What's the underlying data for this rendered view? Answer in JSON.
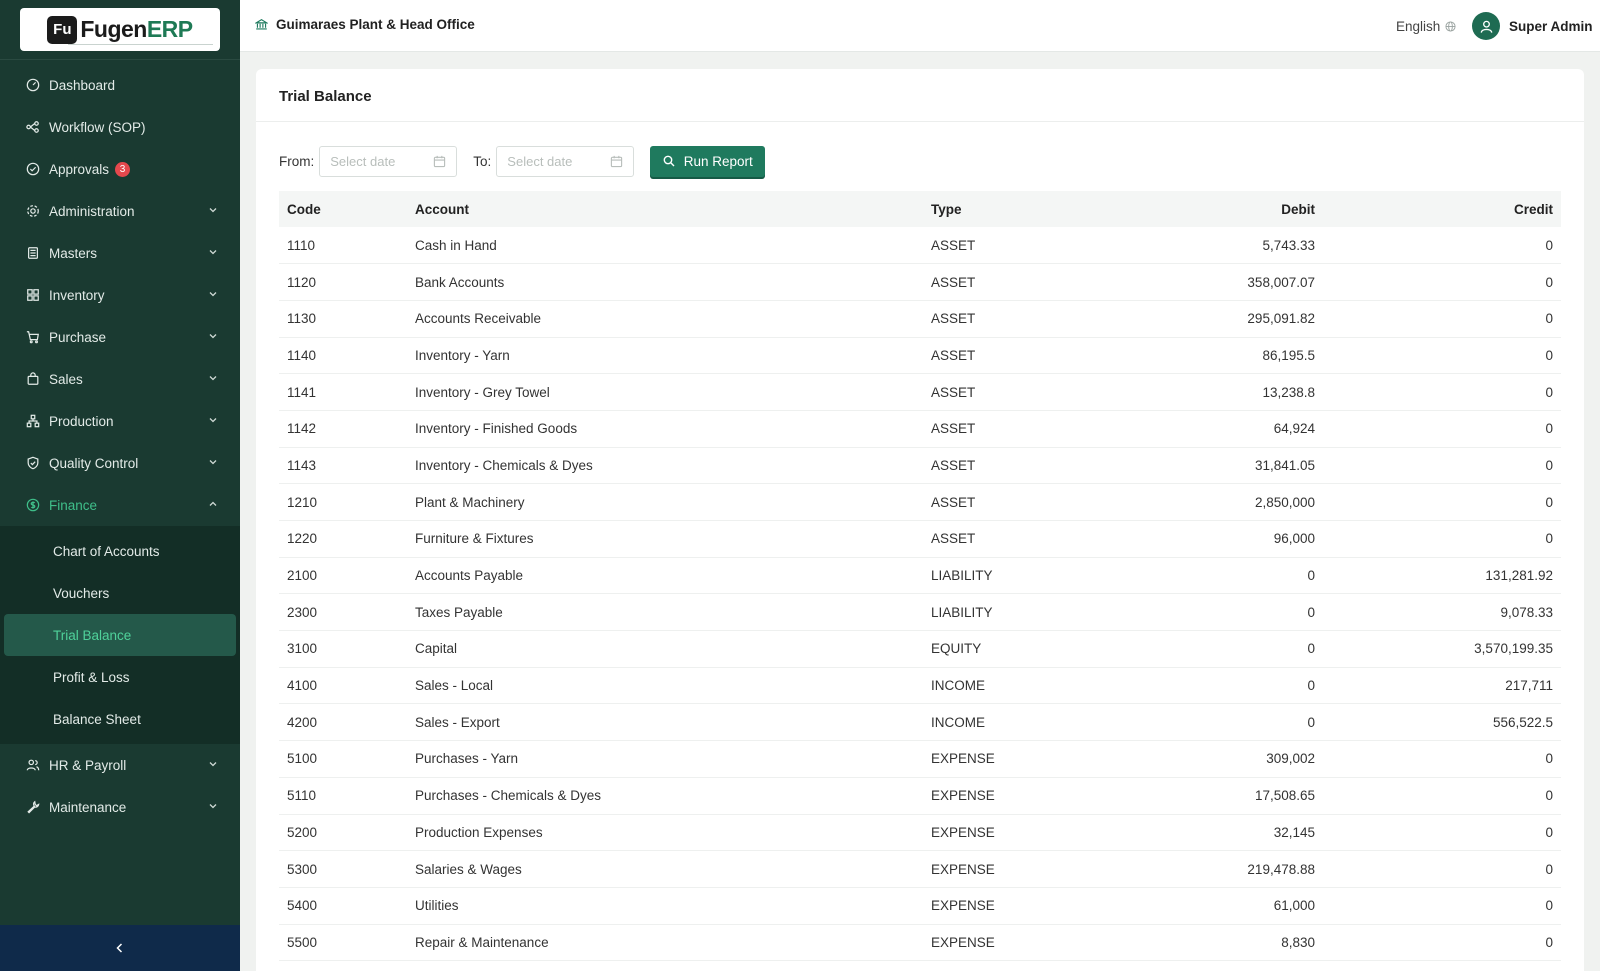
{
  "app": {
    "logo_mark": "Fu",
    "logo_name": "Fugen",
    "logo_suffix": "ERP"
  },
  "header": {
    "org_name": "Guimaraes Plant & Head Office",
    "language": "English",
    "user_name": "Super Admin"
  },
  "sidebar": {
    "items": [
      {
        "label": "Dashboard",
        "icon": "dashboard-icon"
      },
      {
        "label": "Workflow (SOP)",
        "icon": "workflow-icon"
      },
      {
        "label": "Approvals",
        "icon": "approvals-icon",
        "badge": "3"
      },
      {
        "label": "Administration",
        "icon": "gear-icon"
      },
      {
        "label": "Masters",
        "icon": "masters-icon"
      },
      {
        "label": "Inventory",
        "icon": "inventory-icon"
      },
      {
        "label": "Purchase",
        "icon": "cart-icon"
      },
      {
        "label": "Sales",
        "icon": "bag-icon"
      },
      {
        "label": "Production",
        "icon": "production-icon"
      },
      {
        "label": "Quality Control",
        "icon": "shield-icon"
      },
      {
        "label": "Finance",
        "icon": "dollar-icon"
      },
      {
        "label": "HR & Payroll",
        "icon": "users-icon"
      },
      {
        "label": "Maintenance",
        "icon": "wrench-icon"
      }
    ],
    "finance_submenu": [
      {
        "label": "Chart of Accounts"
      },
      {
        "label": "Vouchers"
      },
      {
        "label": "Trial Balance"
      },
      {
        "label": "Profit & Loss"
      },
      {
        "label": "Balance Sheet"
      }
    ]
  },
  "page": {
    "title": "Trial Balance",
    "from_label": "From",
    "to_label": "To",
    "from_placeholder": "Select date",
    "to_placeholder": "Select date",
    "run_label": "Run Report"
  },
  "table": {
    "headers": {
      "code": "Code",
      "account": "Account",
      "type": "Type",
      "debit": "Debit",
      "credit": "Credit"
    },
    "rows": [
      {
        "code": "1110",
        "account": "Cash in Hand",
        "type": "ASSET",
        "debit": "5,743.33",
        "credit": "0"
      },
      {
        "code": "1120",
        "account": "Bank Accounts",
        "type": "ASSET",
        "debit": "358,007.07",
        "credit": "0"
      },
      {
        "code": "1130",
        "account": "Accounts Receivable",
        "type": "ASSET",
        "debit": "295,091.82",
        "credit": "0"
      },
      {
        "code": "1140",
        "account": "Inventory - Yarn",
        "type": "ASSET",
        "debit": "86,195.5",
        "credit": "0"
      },
      {
        "code": "1141",
        "account": "Inventory - Grey Towel",
        "type": "ASSET",
        "debit": "13,238.8",
        "credit": "0"
      },
      {
        "code": "1142",
        "account": "Inventory - Finished Goods",
        "type": "ASSET",
        "debit": "64,924",
        "credit": "0"
      },
      {
        "code": "1143",
        "account": "Inventory - Chemicals & Dyes",
        "type": "ASSET",
        "debit": "31,841.05",
        "credit": "0"
      },
      {
        "code": "1210",
        "account": "Plant & Machinery",
        "type": "ASSET",
        "debit": "2,850,000",
        "credit": "0"
      },
      {
        "code": "1220",
        "account": "Furniture & Fixtures",
        "type": "ASSET",
        "debit": "96,000",
        "credit": "0"
      },
      {
        "code": "2100",
        "account": "Accounts Payable",
        "type": "LIABILITY",
        "debit": "0",
        "credit": "131,281.92"
      },
      {
        "code": "2300",
        "account": "Taxes Payable",
        "type": "LIABILITY",
        "debit": "0",
        "credit": "9,078.33"
      },
      {
        "code": "3100",
        "account": "Capital",
        "type": "EQUITY",
        "debit": "0",
        "credit": "3,570,199.35"
      },
      {
        "code": "4100",
        "account": "Sales - Local",
        "type": "INCOME",
        "debit": "0",
        "credit": "217,711"
      },
      {
        "code": "4200",
        "account": "Sales - Export",
        "type": "INCOME",
        "debit": "0",
        "credit": "556,522.5"
      },
      {
        "code": "5100",
        "account": "Purchases - Yarn",
        "type": "EXPENSE",
        "debit": "309,002",
        "credit": "0"
      },
      {
        "code": "5110",
        "account": "Purchases - Chemicals & Dyes",
        "type": "EXPENSE",
        "debit": "17,508.65",
        "credit": "0"
      },
      {
        "code": "5200",
        "account": "Production Expenses",
        "type": "EXPENSE",
        "debit": "32,145",
        "credit": "0"
      },
      {
        "code": "5300",
        "account": "Salaries & Wages",
        "type": "EXPENSE",
        "debit": "219,478.88",
        "credit": "0"
      },
      {
        "code": "5400",
        "account": "Utilities",
        "type": "EXPENSE",
        "debit": "61,000",
        "credit": "0"
      },
      {
        "code": "5500",
        "account": "Repair & Maintenance",
        "type": "EXPENSE",
        "debit": "8,830",
        "credit": "0"
      }
    ]
  },
  "colors": {
    "sidebar_bg": "#1a3a31",
    "accent": "#1f7a5e",
    "active_text": "#4fd19a",
    "badge": "#e5484d"
  }
}
